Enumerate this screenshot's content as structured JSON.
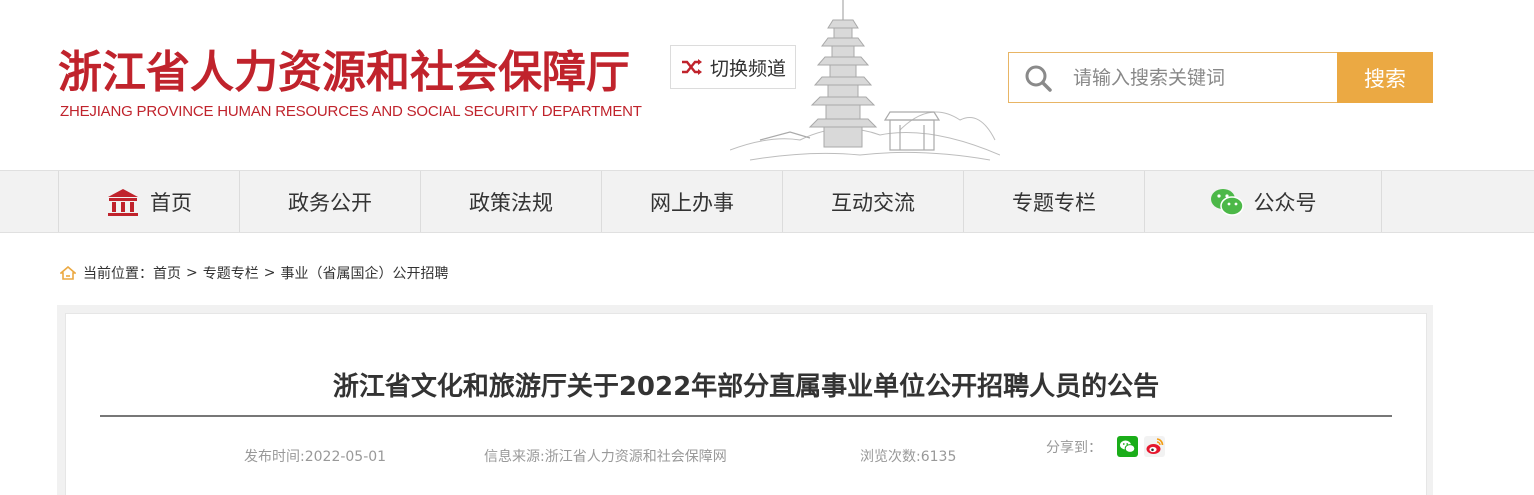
{
  "header": {
    "logo_cn": "浙江省人力资源和社会保障厅",
    "logo_en": "ZHEJIANG PROVINCE HUMAN RESOURCES AND SOCIAL SECURITY DEPARTMENT",
    "switch_label": "切换频道"
  },
  "search": {
    "placeholder": "请输入搜索关键词",
    "button_label": "搜索"
  },
  "nav": {
    "items": [
      {
        "label": "首页",
        "icon": "building-icon"
      },
      {
        "label": "政务公开"
      },
      {
        "label": "政策法规"
      },
      {
        "label": "网上办事"
      },
      {
        "label": "互动交流"
      },
      {
        "label": "专题专栏"
      },
      {
        "label": "公众号",
        "icon": "wechat-icon"
      }
    ]
  },
  "breadcrumb": {
    "prefix": "当前位置：",
    "items": [
      "首页",
      "专题专栏",
      "事业（省属国企）公开招聘"
    ],
    "separator": ">"
  },
  "article": {
    "title": "浙江省文化和旅游厅关于2022年部分直属事业单位公开招聘人员的公告",
    "publish_time": "发布时间:2022-05-01",
    "source": "信息来源:浙江省人力资源和社会保障网",
    "views": "浏览次数:6135",
    "share_label": "分享到："
  },
  "colors": {
    "brand_red": "#c0232c",
    "accent_orange": "#eba943",
    "wechat_green": "#1aad19",
    "weibo_red": "#e6162d"
  }
}
